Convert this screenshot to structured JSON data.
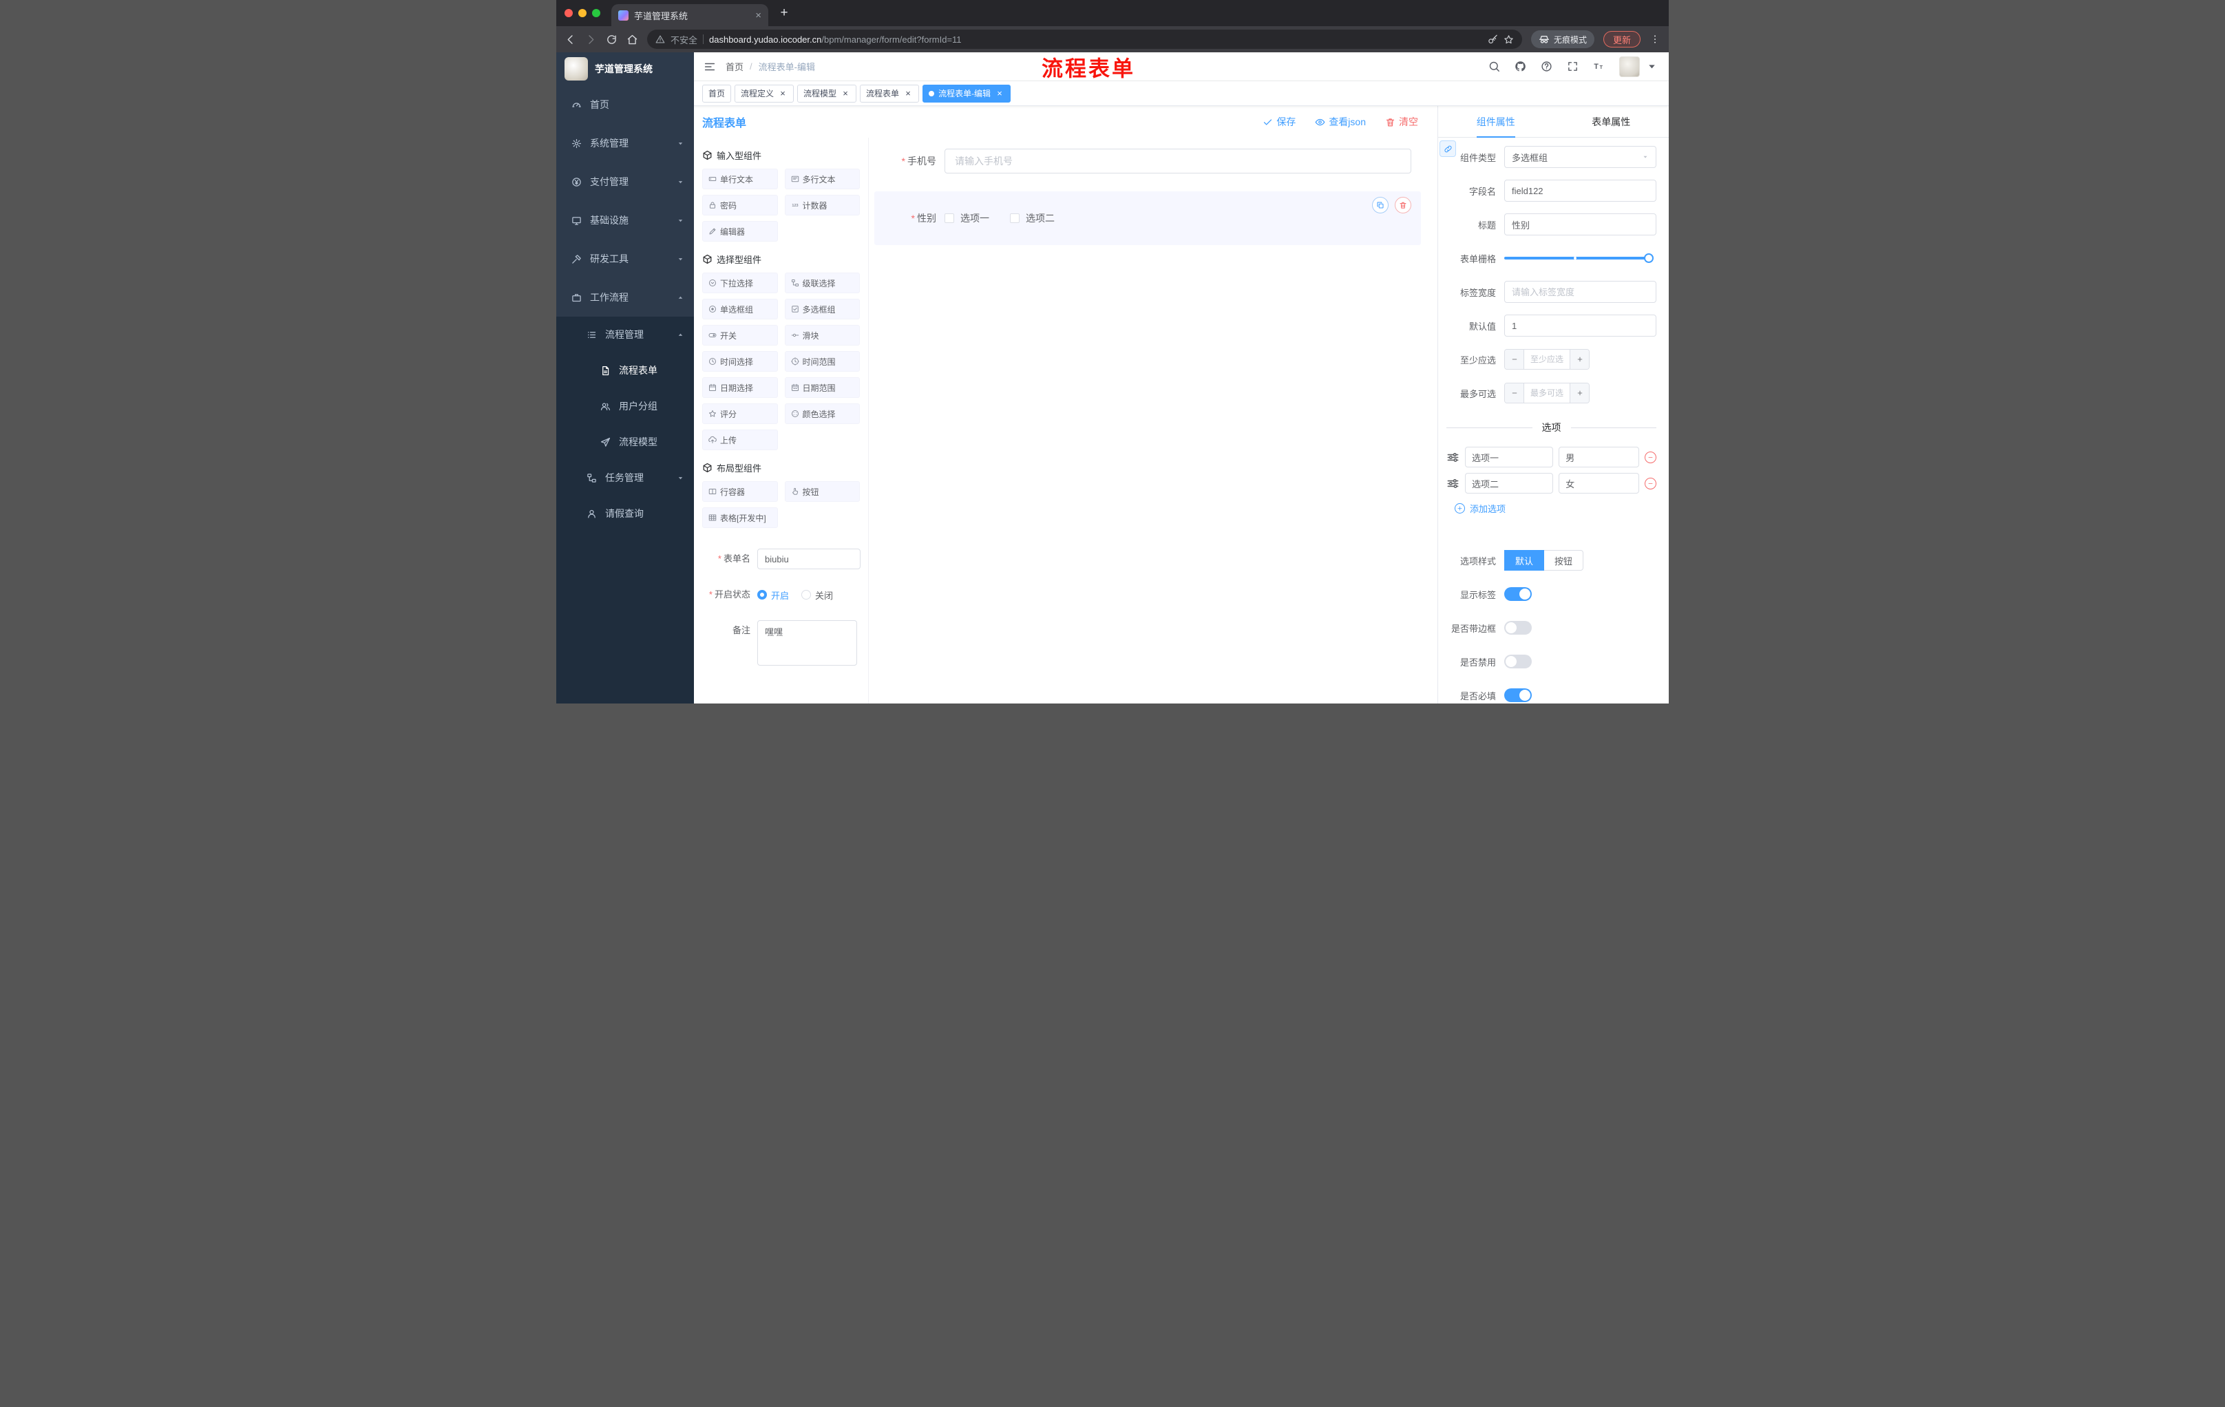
{
  "colors": {
    "primary": "#409eff",
    "danger": "#f56c6c",
    "sidebar_bg": "#2d3a4b",
    "submenu_bg": "#1f2d3d",
    "annotation_red": "#f8150d",
    "tag_active_bg": "#409eff"
  },
  "marks": {
    "required": "*",
    "close": "×",
    "plus": "+"
  },
  "annotation": "流程表单",
  "browser": {
    "tab_title": "芋道管理系统",
    "security_label": "不安全",
    "url_host": "dashboard.yudao.iocoder.cn",
    "url_path": "/bpm/manager/form/edit?formId=11",
    "incognito_label": "无痕模式",
    "update_label": "更新"
  },
  "sidebar": {
    "logo_title": "芋道管理系统",
    "items": [
      {
        "name": "sidebar-item-home",
        "icon": "dashboard-icon",
        "ref": "#ic-gauge",
        "label": "首页"
      },
      {
        "name": "sidebar-item-system",
        "icon": "gear-icon",
        "ref": "#ic-gear",
        "label": "系统管理",
        "has_arrow": true
      },
      {
        "name": "sidebar-item-payment",
        "icon": "yen-icon",
        "ref": "#ic-yen",
        "label": "支付管理",
        "has_arrow": true
      },
      {
        "name": "sidebar-item-infrastructure",
        "icon": "monitor-icon",
        "ref": "#ic-monitor",
        "label": "基础设施",
        "has_arrow": true
      },
      {
        "name": "sidebar-item-devtools",
        "icon": "tools-icon",
        "ref": "#ic-tool",
        "label": "研发工具",
        "has_arrow": true
      },
      {
        "name": "sidebar-item-workflow",
        "icon": "briefcase-icon",
        "ref": "#ic-case",
        "label": "工作流程",
        "has_arrow": true,
        "arrow_up": true
      },
      {
        "name": "sidebar-item-process-management",
        "icon": "list-icon",
        "ref": "#ic-list",
        "label": "流程管理",
        "has_arrow": true,
        "arrow_up": true,
        "dark": true,
        "l1": true
      },
      {
        "name": "sidebar-item-process-form",
        "icon": "document-icon",
        "ref": "#ic-doc",
        "label": "流程表单",
        "dark": true,
        "l2": true,
        "active": true
      },
      {
        "name": "sidebar-item-user-group",
        "icon": "users-icon",
        "ref": "#ic-users",
        "label": "用户分组",
        "dark": true,
        "l2": true
      },
      {
        "name": "sidebar-item-process-model",
        "icon": "send-icon",
        "ref": "#ic-send",
        "label": "流程模型",
        "dark": true,
        "l2": true
      },
      {
        "name": "sidebar-item-task-management",
        "icon": "flow-icon",
        "ref": "#ic-flow",
        "label": "任务管理",
        "has_arrow": true,
        "dark": true,
        "l1": true
      },
      {
        "name": "sidebar-item-leave-query",
        "icon": "person-icon",
        "ref": "#ic-user",
        "label": "请假查询",
        "dark": true,
        "l1": true
      }
    ]
  },
  "breadcrumb": {
    "home": "首页",
    "sep": "/",
    "current": "流程表单-编辑"
  },
  "tags": [
    {
      "name": "tag-home",
      "label": "首页",
      "pinned": true
    },
    {
      "name": "tag-process-definition",
      "label": "流程定义"
    },
    {
      "name": "tag-process-model",
      "label": "流程模型"
    },
    {
      "name": "tag-process-form",
      "label": "流程表单"
    },
    {
      "name": "tag-process-form-edit",
      "label": "流程表单-编辑",
      "active": true
    }
  ],
  "designer": {
    "title": "流程表单",
    "actions": [
      {
        "name": "save-button",
        "icon": "check-icon",
        "ref": "#ic-check",
        "label": "保存"
      },
      {
        "name": "view-json-button",
        "icon": "eye-icon",
        "ref": "#ic-eye",
        "label": "查看json"
      },
      {
        "name": "clear-button",
        "icon": "trash-icon",
        "ref": "#ic-trash",
        "label": "清空",
        "danger": true
      }
    ]
  },
  "palette": {
    "sections": [
      {
        "title": "输入型组件",
        "items": [
          {
            "name": "palette-item-single-line-text",
            "icon": "text-input-icon",
            "ref": "#ic-input",
            "label": "单行文本"
          },
          {
            "name": "palette-item-multi-line-text",
            "icon": "textarea-icon",
            "ref": "#ic-textarea",
            "label": "多行文本"
          },
          {
            "name": "palette-item-password",
            "icon": "lock-icon",
            "ref": "#ic-lock",
            "label": "密码"
          },
          {
            "name": "palette-item-counter",
            "icon": "counter-icon",
            "ref": "#ic-counter",
            "label": "计数器"
          },
          {
            "name": "palette-item-editor",
            "icon": "editor-icon",
            "ref": "#ic-edit",
            "label": "编辑器"
          }
        ]
      },
      {
        "title": "选择型组件",
        "items": [
          {
            "name": "palette-item-select",
            "icon": "select-icon",
            "ref": "#ic-select",
            "label": "下拉选择"
          },
          {
            "name": "palette-item-cascader",
            "icon": "cascader-icon",
            "ref": "#ic-flow",
            "label": "级联选择"
          },
          {
            "name": "palette-item-radio-group",
            "icon": "radio-icon",
            "ref": "#ic-radio",
            "label": "单选框组"
          },
          {
            "name": "palette-item-checkbox-group",
            "icon": "checkbox-icon",
            "ref": "#ic-checkbox",
            "label": "多选框组"
          },
          {
            "name": "palette-item-switch",
            "icon": "switch-icon",
            "ref": "#ic-switch",
            "label": "开关"
          },
          {
            "name": "palette-item-slider",
            "icon": "slider-icon",
            "ref": "#ic-slider",
            "label": "滑块"
          },
          {
            "name": "palette-item-time-picker",
            "icon": "clock-icon",
            "ref": "#ic-time",
            "label": "时间选择"
          },
          {
            "name": "palette-item-time-range",
            "icon": "clock-range-icon",
            "ref": "#ic-timerange",
            "label": "时间范围"
          },
          {
            "name": "palette-item-date-picker",
            "icon": "calendar-icon",
            "ref": "#ic-date",
            "label": "日期选择"
          },
          {
            "name": "palette-item-date-range",
            "icon": "calendar-range-icon",
            "ref": "#ic-daterange",
            "label": "日期范围"
          },
          {
            "name": "palette-item-rate",
            "icon": "star-icon",
            "ref": "#ic-star",
            "label": "评分"
          },
          {
            "name": "palette-item-color-picker",
            "icon": "color-icon",
            "ref": "#ic-color",
            "label": "颜色选择"
          },
          {
            "name": "palette-item-upload",
            "icon": "upload-icon",
            "ref": "#ic-upload",
            "label": "上传"
          }
        ]
      },
      {
        "title": "布局型组件",
        "items": [
          {
            "name": "palette-item-row-container",
            "icon": "row-container-icon",
            "ref": "#ic-row",
            "label": "行容器"
          },
          {
            "name": "palette-item-button",
            "icon": "pointer-icon",
            "ref": "#ic-pointer",
            "label": "按钮"
          },
          {
            "name": "palette-item-table",
            "icon": "table-icon",
            "ref": "#ic-table",
            "label": "表格[开发中]"
          }
        ]
      }
    ],
    "form": {
      "name_label": "表单名",
      "name_value": "biubiu",
      "status_label": "开启状态",
      "status_options": [
        {
          "label": "开启",
          "on": true
        },
        {
          "label": "关闭"
        }
      ],
      "remark_label": "备注",
      "remark_value": "嘿嘿"
    }
  },
  "canvas": {
    "phone": {
      "label": "手机号",
      "placeholder": "请输入手机号"
    },
    "gender": {
      "label": "性别",
      "options": [
        "选项一",
        "选项二"
      ]
    }
  },
  "props": {
    "tabs": [
      {
        "name": "tab-component-props",
        "label": "组件属性",
        "active": true
      },
      {
        "name": "tab-form-props",
        "label": "表单属性"
      }
    ],
    "component_type_label": "组件类型",
    "component_type_value": "多选框组",
    "field_label": "字段名",
    "field_value": "field122",
    "title_label": "标题",
    "title_value": "性别",
    "grid_label": "表单栅格",
    "label_width_label": "标签宽度",
    "label_width_placeholder": "请输入标签宽度",
    "default_label": "默认值",
    "default_value": "1",
    "min_label": "至少应选",
    "min_placeholder": "至少应选",
    "max_label": "最多可选",
    "max_placeholder": "最多可选",
    "options_divider": "选项",
    "options": [
      {
        "label": "选项一",
        "value": "男"
      },
      {
        "label": "选项二",
        "value": "女"
      }
    ],
    "add_option_label": "添加选项",
    "style_label": "选项样式",
    "style_options": [
      {
        "label": "默认",
        "active": true
      },
      {
        "label": "按钮"
      }
    ],
    "switches": [
      {
        "name": "show-label-switch",
        "label": "显示标签",
        "on": true
      },
      {
        "name": "border-switch",
        "label": "是否带边框",
        "on": false
      },
      {
        "name": "disabled-switch",
        "label": "是否禁用",
        "on": false
      },
      {
        "name": "required-switch",
        "label": "是否必填",
        "on": true
      }
    ]
  }
}
